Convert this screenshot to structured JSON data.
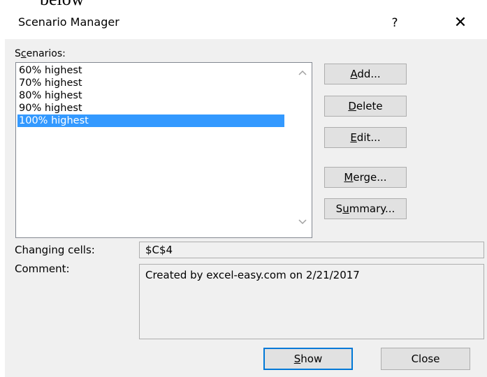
{
  "background": {
    "partial_text": "below"
  },
  "dialog": {
    "title": "Scenario Manager",
    "help_glyph": "?",
    "close_glyph": "✕"
  },
  "scenarios": {
    "label_pre": "S",
    "label_acc": "c",
    "label_post": "enarios:",
    "items": [
      {
        "label": "60% highest",
        "selected": false
      },
      {
        "label": "70% highest",
        "selected": false
      },
      {
        "label": "80% highest",
        "selected": false
      },
      {
        "label": "90% highest",
        "selected": false
      },
      {
        "label": "100% highest",
        "selected": true
      }
    ],
    "scroll_up_icon": "chevron-up-icon",
    "scroll_down_icon": "chevron-down-icon"
  },
  "buttons": {
    "add": {
      "pre": "",
      "acc": "A",
      "post": "dd..."
    },
    "delete": {
      "pre": "",
      "acc": "D",
      "post": "elete"
    },
    "edit": {
      "pre": "",
      "acc": "E",
      "post": "dit..."
    },
    "merge": {
      "pre": "",
      "acc": "M",
      "post": "erge..."
    },
    "summary": {
      "pre": "S",
      "acc": "u",
      "post": "mmary..."
    }
  },
  "fields": {
    "changing_cells_label": "Changing cells:",
    "changing_cells_value": "$C$4",
    "comment_label": "Comment:",
    "comment_value": "Created by excel-easy.com on 2/21/2017"
  },
  "footer": {
    "show": {
      "pre": "",
      "acc": "S",
      "post": "how"
    },
    "close": "Close"
  },
  "colors": {
    "selection": "#3399ff",
    "dialog_bg": "#f0f0f0",
    "default_button_border": "#0078d7"
  }
}
